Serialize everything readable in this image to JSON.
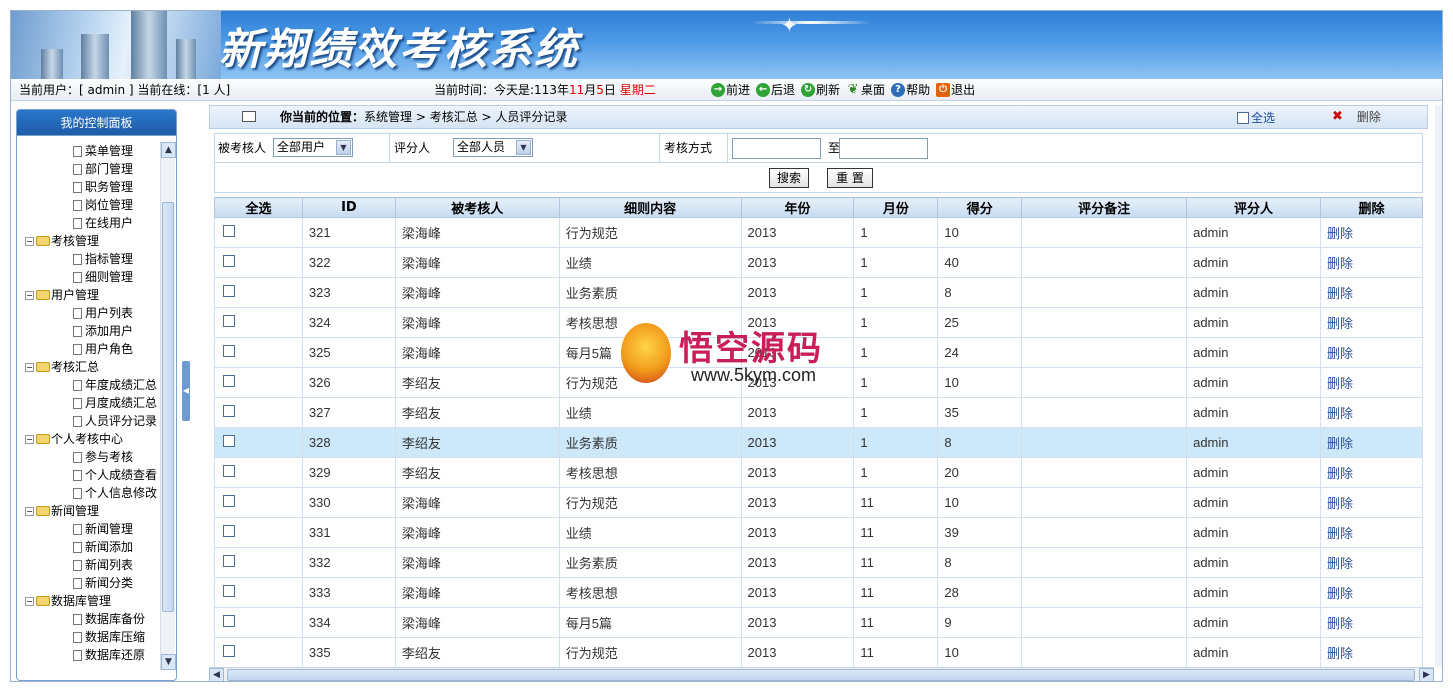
{
  "header": {
    "title": "新翔绩效考核系统",
    "current_user": "当前用户：[ admin ] 当前在线：[1 人]",
    "time_prefix": "当前时间：今天是:113年",
    "time_month": "11",
    "time_mid1": "月",
    "time_day": "5",
    "time_mid2": "日",
    "weekday": "星期二",
    "nav": {
      "forward": "前进",
      "back": "后退",
      "refresh": "刷新",
      "desktop": "桌面",
      "help": "帮助",
      "logout": "退出"
    }
  },
  "sidebar": {
    "title": "我的控制面板",
    "groups": [
      {
        "items": [
          "菜单管理",
          "部门管理",
          "职务管理",
          "岗位管理",
          "在线用户"
        ]
      },
      {
        "label": "考核管理",
        "items": [
          "指标管理",
          "细则管理"
        ]
      },
      {
        "label": "用户管理",
        "items": [
          "用户列表",
          "添加用户",
          "用户角色"
        ]
      },
      {
        "label": "考核汇总",
        "items": [
          "年度成绩汇总",
          "月度成绩汇总",
          "人员评分记录"
        ]
      },
      {
        "label": "个人考核中心",
        "items": [
          "参与考核",
          "个人成绩查看",
          "个人信息修改"
        ]
      },
      {
        "label": "新闻管理",
        "items": [
          "新闻管理",
          "新闻添加",
          "新闻列表",
          "新闻分类"
        ]
      },
      {
        "label": "数据库管理",
        "items": [
          "数据库备份",
          "数据库压缩",
          "数据库还原"
        ]
      }
    ]
  },
  "location": {
    "label": "你当前的位置：",
    "path": "系统管理 > 考核汇总 > 人员评分记录",
    "select_all": "全选",
    "delete": "删除"
  },
  "filter": {
    "assessee_label": "被考核人",
    "assessee_value": "全部用户",
    "rater_label": "评分人",
    "rater_value": "全部人员",
    "method_label": "考核方式",
    "to_label": "至",
    "search_btn": "搜索",
    "reset_btn": "重 置"
  },
  "table": {
    "headers": [
      "全选",
      "ID",
      "被考核人",
      "细则内容",
      "年份",
      "月份",
      "得分",
      "评分备注",
      "评分人",
      "删除"
    ],
    "highlight_row": 7,
    "rows": [
      [
        "321",
        "梁海峰",
        "行为规范",
        "2013",
        "1",
        "10",
        "",
        "admin",
        "删除"
      ],
      [
        "322",
        "梁海峰",
        "业绩",
        "2013",
        "1",
        "40",
        "",
        "admin",
        "删除"
      ],
      [
        "323",
        "梁海峰",
        "业务素质",
        "2013",
        "1",
        "8",
        "",
        "admin",
        "删除"
      ],
      [
        "324",
        "梁海峰",
        "考核思想",
        "2013",
        "1",
        "25",
        "",
        "admin",
        "删除"
      ],
      [
        "325",
        "梁海峰",
        "每月5篇",
        "2013",
        "1",
        "24",
        "",
        "admin",
        "删除"
      ],
      [
        "326",
        "李绍友",
        "行为规范",
        "2013",
        "1",
        "10",
        "",
        "admin",
        "删除"
      ],
      [
        "327",
        "李绍友",
        "业绩",
        "2013",
        "1",
        "35",
        "",
        "admin",
        "删除"
      ],
      [
        "328",
        "李绍友",
        "业务素质",
        "2013",
        "1",
        "8",
        "",
        "admin",
        "删除"
      ],
      [
        "329",
        "李绍友",
        "考核思想",
        "2013",
        "1",
        "20",
        "",
        "admin",
        "删除"
      ],
      [
        "330",
        "梁海峰",
        "行为规范",
        "2013",
        "11",
        "10",
        "",
        "admin",
        "删除"
      ],
      [
        "331",
        "梁海峰",
        "业绩",
        "2013",
        "11",
        "39",
        "",
        "admin",
        "删除"
      ],
      [
        "332",
        "梁海峰",
        "业务素质",
        "2013",
        "11",
        "8",
        "",
        "admin",
        "删除"
      ],
      [
        "333",
        "梁海峰",
        "考核思想",
        "2013",
        "11",
        "28",
        "",
        "admin",
        "删除"
      ],
      [
        "334",
        "梁海峰",
        "每月5篇",
        "2013",
        "11",
        "9",
        "",
        "admin",
        "删除"
      ],
      [
        "335",
        "李绍友",
        "行为规范",
        "2013",
        "11",
        "10",
        "",
        "admin",
        "删除"
      ]
    ]
  },
  "watermark": {
    "text": "悟空源码",
    "url": "www.5kym.com"
  }
}
